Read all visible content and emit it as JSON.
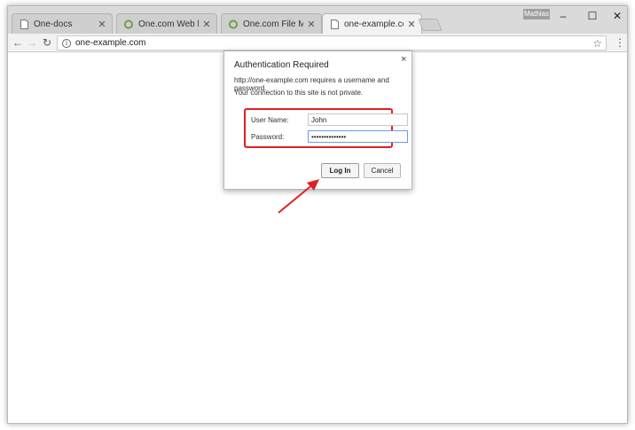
{
  "browser": {
    "tabs": [
      {
        "title": "One-docs",
        "favicon": "document-icon",
        "active": false
      },
      {
        "title": "One.com Web hosting -",
        "favicon": "onecom-logo-icon",
        "active": false
      },
      {
        "title": "One.com File Manager",
        "favicon": "onecom-logo-icon",
        "active": false
      },
      {
        "title": "one-example.com",
        "favicon": "document-icon",
        "active": true
      }
    ],
    "profile_name": "Mathias",
    "address_bar": {
      "url": "one-example.com"
    },
    "window_controls": {
      "minimize": "–",
      "maximize": "☐",
      "close": "✕"
    }
  },
  "auth_dialog": {
    "title": "Authentication Required",
    "message": "http://one-example.com requires a username and password.",
    "privacy_note": "Your connection to this site is not private.",
    "username_label": "User Name:",
    "username_value": "John",
    "password_label": "Password:",
    "password_value": "••••••••••••••",
    "login_label": "Log In",
    "cancel_label": "Cancel",
    "close_glyph": "×"
  },
  "annotations": {
    "highlight_color": "#e02020",
    "arrow_color": "#e02020"
  }
}
